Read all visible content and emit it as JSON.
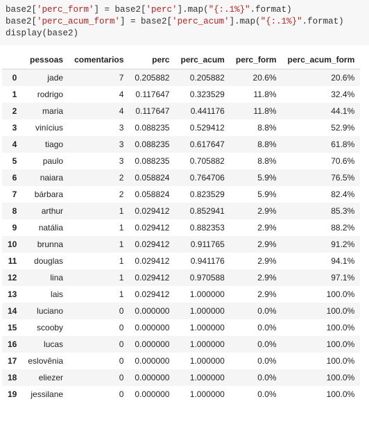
{
  "code": {
    "l1a": "base2[",
    "l1b": "'perc_form'",
    "l1c": "] = base2[",
    "l1d": "'perc'",
    "l1e": "].map(",
    "l1f": "\"{:.1%}\"",
    "l1g": ".format)",
    "l2a": "base2[",
    "l2b": "'perc_acum_form'",
    "l2c": "] = base2[",
    "l2d": "'perc_acum'",
    "l2e": "].map(",
    "l2f": "\"{:.1%}\"",
    "l2g": ".format)",
    "l3": "display(base2)"
  },
  "columns": [
    "pessoas",
    "comentarios",
    "perc",
    "perc_acum",
    "perc_form",
    "perc_acum_form"
  ],
  "rows": [
    {
      "idx": "0",
      "pessoas": "jade",
      "comentarios": "7",
      "perc": "0.205882",
      "perc_acum": "0.205882",
      "perc_form": "20.6%",
      "perc_acum_form": "20.6%"
    },
    {
      "idx": "1",
      "pessoas": "rodrigo",
      "comentarios": "4",
      "perc": "0.117647",
      "perc_acum": "0.323529",
      "perc_form": "11.8%",
      "perc_acum_form": "32.4%"
    },
    {
      "idx": "2",
      "pessoas": "maria",
      "comentarios": "4",
      "perc": "0.117647",
      "perc_acum": "0.441176",
      "perc_form": "11.8%",
      "perc_acum_form": "44.1%"
    },
    {
      "idx": "3",
      "pessoas": "vinícius",
      "comentarios": "3",
      "perc": "0.088235",
      "perc_acum": "0.529412",
      "perc_form": "8.8%",
      "perc_acum_form": "52.9%"
    },
    {
      "idx": "4",
      "pessoas": "tiago",
      "comentarios": "3",
      "perc": "0.088235",
      "perc_acum": "0.617647",
      "perc_form": "8.8%",
      "perc_acum_form": "61.8%"
    },
    {
      "idx": "5",
      "pessoas": "paulo",
      "comentarios": "3",
      "perc": "0.088235",
      "perc_acum": "0.705882",
      "perc_form": "8.8%",
      "perc_acum_form": "70.6%"
    },
    {
      "idx": "6",
      "pessoas": "naiara",
      "comentarios": "2",
      "perc": "0.058824",
      "perc_acum": "0.764706",
      "perc_form": "5.9%",
      "perc_acum_form": "76.5%"
    },
    {
      "idx": "7",
      "pessoas": "bárbara",
      "comentarios": "2",
      "perc": "0.058824",
      "perc_acum": "0.823529",
      "perc_form": "5.9%",
      "perc_acum_form": "82.4%"
    },
    {
      "idx": "8",
      "pessoas": "arthur",
      "comentarios": "1",
      "perc": "0.029412",
      "perc_acum": "0.852941",
      "perc_form": "2.9%",
      "perc_acum_form": "85.3%"
    },
    {
      "idx": "9",
      "pessoas": "natália",
      "comentarios": "1",
      "perc": "0.029412",
      "perc_acum": "0.882353",
      "perc_form": "2.9%",
      "perc_acum_form": "88.2%"
    },
    {
      "idx": "10",
      "pessoas": "brunna",
      "comentarios": "1",
      "perc": "0.029412",
      "perc_acum": "0.911765",
      "perc_form": "2.9%",
      "perc_acum_form": "91.2%"
    },
    {
      "idx": "11",
      "pessoas": "douglas",
      "comentarios": "1",
      "perc": "0.029412",
      "perc_acum": "0.941176",
      "perc_form": "2.9%",
      "perc_acum_form": "94.1%"
    },
    {
      "idx": "12",
      "pessoas": "lina",
      "comentarios": "1",
      "perc": "0.029412",
      "perc_acum": "0.970588",
      "perc_form": "2.9%",
      "perc_acum_form": "97.1%"
    },
    {
      "idx": "13",
      "pessoas": "lais",
      "comentarios": "1",
      "perc": "0.029412",
      "perc_acum": "1.000000",
      "perc_form": "2.9%",
      "perc_acum_form": "100.0%"
    },
    {
      "idx": "14",
      "pessoas": "luciano",
      "comentarios": "0",
      "perc": "0.000000",
      "perc_acum": "1.000000",
      "perc_form": "0.0%",
      "perc_acum_form": "100.0%"
    },
    {
      "idx": "15",
      "pessoas": "scooby",
      "comentarios": "0",
      "perc": "0.000000",
      "perc_acum": "1.000000",
      "perc_form": "0.0%",
      "perc_acum_form": "100.0%"
    },
    {
      "idx": "16",
      "pessoas": "lucas",
      "comentarios": "0",
      "perc": "0.000000",
      "perc_acum": "1.000000",
      "perc_form": "0.0%",
      "perc_acum_form": "100.0%"
    },
    {
      "idx": "17",
      "pessoas": "eslovênia",
      "comentarios": "0",
      "perc": "0.000000",
      "perc_acum": "1.000000",
      "perc_form": "0.0%",
      "perc_acum_form": "100.0%"
    },
    {
      "idx": "18",
      "pessoas": "eliezer",
      "comentarios": "0",
      "perc": "0.000000",
      "perc_acum": "1.000000",
      "perc_form": "0.0%",
      "perc_acum_form": "100.0%"
    },
    {
      "idx": "19",
      "pessoas": "jessilane",
      "comentarios": "0",
      "perc": "0.000000",
      "perc_acum": "1.000000",
      "perc_form": "0.0%",
      "perc_acum_form": "100.0%"
    }
  ]
}
